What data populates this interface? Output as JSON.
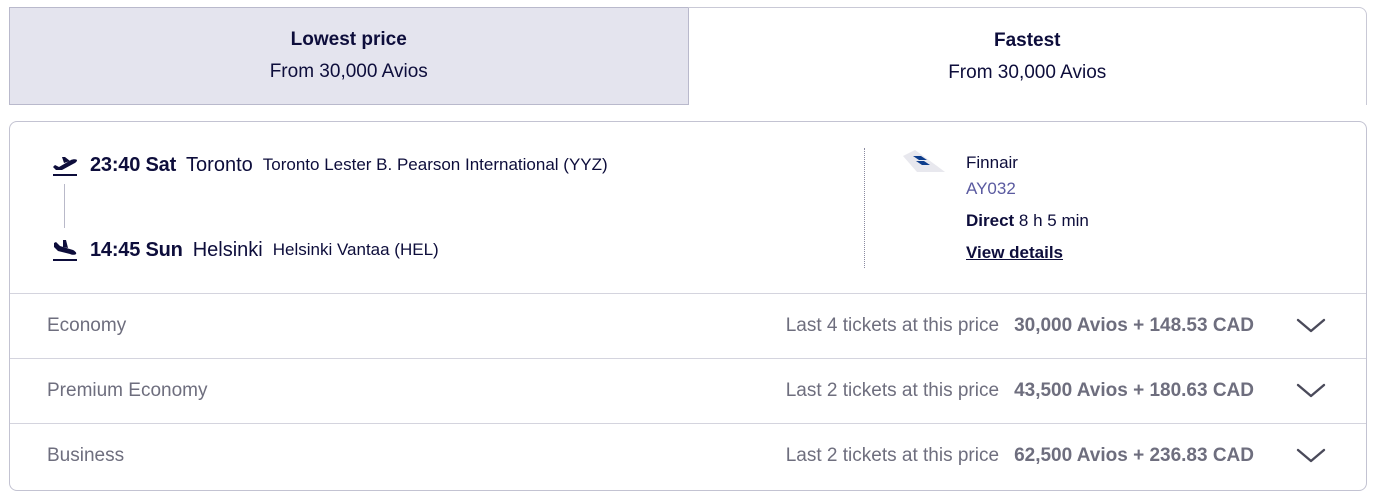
{
  "tabs": [
    {
      "title": "Lowest price",
      "subtitle": "From 30,000 Avios",
      "active": true
    },
    {
      "title": "Fastest",
      "subtitle": "From 30,000 Avios",
      "active": false
    }
  ],
  "flight": {
    "departure": {
      "time": "23:40 Sat",
      "city": "Toronto",
      "airport": "Toronto Lester B. Pearson International (YYZ)",
      "icon": "takeoff-icon"
    },
    "arrival": {
      "time": "14:45 Sun",
      "city": "Helsinki",
      "airport": "Helsinki Vantaa (HEL)",
      "icon": "landing-icon"
    },
    "airline": {
      "name": "Finnair",
      "flight_number": "AY032",
      "logo": "finnair-logo"
    },
    "stops_label": "Direct",
    "duration": "8 h 5 min",
    "details_link": "View details"
  },
  "fares": [
    {
      "cabin": "Economy",
      "availability": "Last 4 tickets at this price",
      "price": "30,000 Avios + 148.53 CAD"
    },
    {
      "cabin": "Premium Economy",
      "availability": "Last 2 tickets at this price",
      "price": "43,500 Avios + 180.63 CAD"
    },
    {
      "cabin": "Business",
      "availability": "Last 2 tickets at this price",
      "price": "62,500 Avios + 236.83 CAD"
    }
  ],
  "colors": {
    "primary": "#0d0d3b",
    "active_tab_bg": "#e4e4ee",
    "link": "#5a5aa0",
    "muted_text": "#6e6e7e"
  }
}
